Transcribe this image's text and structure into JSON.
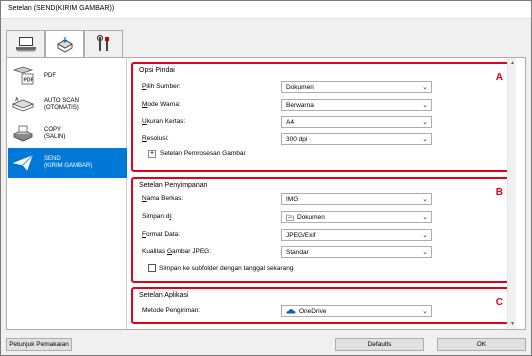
{
  "window": {
    "title": "Setelan (SEND(KIRIM GAMBAR))"
  },
  "tabs": [
    {
      "name": "scan-from-computer",
      "icon": "computer-icon"
    },
    {
      "name": "scan-from-panel",
      "icon": "scanner-panel-icon"
    },
    {
      "name": "general-settings",
      "icon": "tools-icon"
    }
  ],
  "sidebar": {
    "items": [
      {
        "label": "PDF",
        "label2": "",
        "icon": "pdf-icon"
      },
      {
        "label": "AUTO SCAN",
        "label2": "(OTOMATIS)",
        "icon": "auto-scan-icon"
      },
      {
        "label": "COPY",
        "label2": "(SALIN)",
        "icon": "copy-icon"
      },
      {
        "label": "SEND",
        "label2": "(KIRIM GAMBAR)",
        "icon": "send-icon",
        "selected": true
      }
    ]
  },
  "sections": {
    "scan_options": {
      "title": "Opsi Pindai",
      "letter": "A",
      "rows": [
        {
          "label_u": "P",
          "label_rest": "ilih Sumber:",
          "value": "Dokumen"
        },
        {
          "label_u": "M",
          "label_rest": "ode Warna:",
          "value": "Berwarna"
        },
        {
          "label_u": "U",
          "label_rest": "kuran Kertas:",
          "value": "A4"
        },
        {
          "label_u": "R",
          "label_rest": "esolusi:",
          "value": "300 dpi"
        }
      ],
      "expand_label": "Setelan Pemrosesan Gambar"
    },
    "save_settings": {
      "title": "Setelan Penyimpanan",
      "letter": "B",
      "rows": [
        {
          "label_u": "N",
          "label_rest": "ama Berkas:",
          "value": "IMG"
        },
        {
          "label_pre": "Simpan d",
          "label_u": "i",
          "label_rest": ":",
          "value": "Dokumen",
          "icon": "folder-icon"
        },
        {
          "label_u": "F",
          "label_rest": "ormat Data:",
          "value": "JPEG/Exif"
        },
        {
          "label_pre": "Kualitas ",
          "label_u": "G",
          "label_rest": "ambar JPEG:",
          "value": "Standar"
        }
      ],
      "checkbox_label": "Simpan ke subfolder dengan tanggal sekarang",
      "checkbox_checked": false
    },
    "app_settings": {
      "title": "Setelan Aplikasi",
      "letter": "C",
      "rows": [
        {
          "label": "Metode Pengiriman:",
          "value": "OneDrive",
          "icon": "onedrive-icon"
        }
      ]
    }
  },
  "buttons": {
    "manual": "Petunjuk Pemakaian",
    "defaults": "Defaults",
    "ok": "OK"
  }
}
